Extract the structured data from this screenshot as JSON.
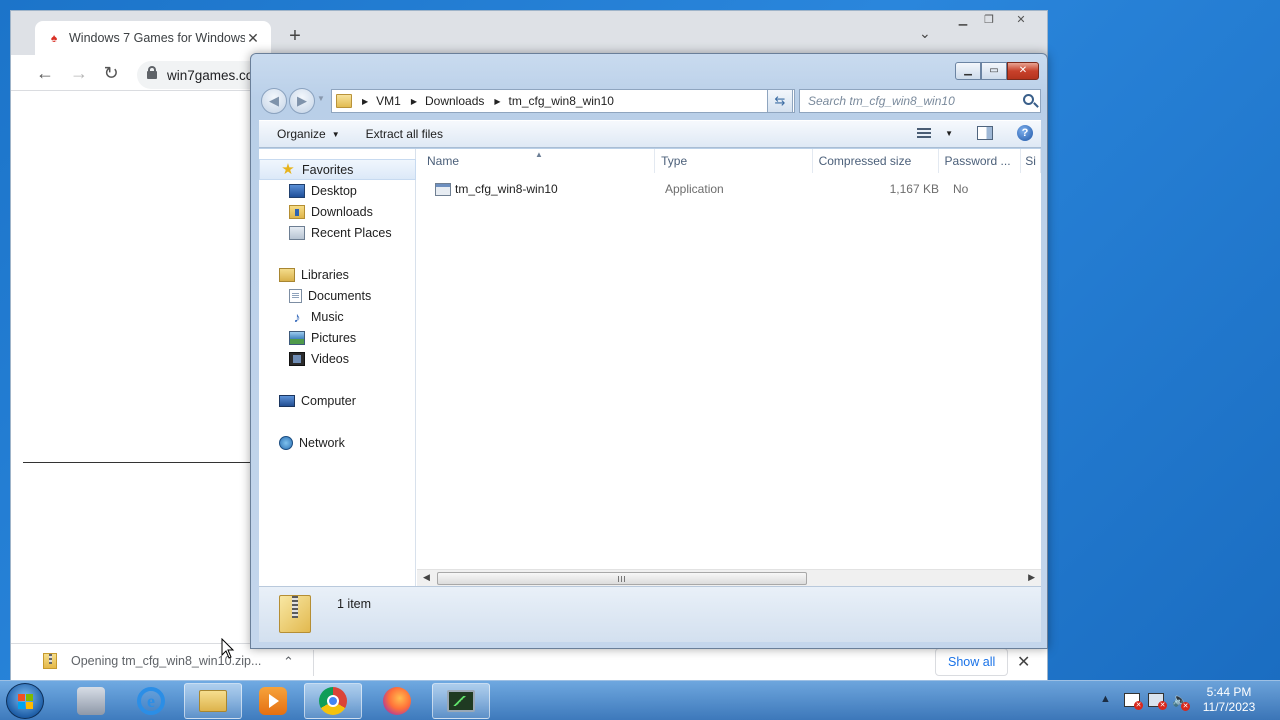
{
  "browser": {
    "tab_title": "Windows 7 Games for Windows",
    "tab_close": "✕",
    "new_tab": "+",
    "tab_menu": "⌄",
    "url": "win7games.co",
    "download": {
      "status": "Opening tm_cfg_win8_win10.zip...",
      "chevron": "⌃",
      "show_all": "Show all",
      "close": "✕"
    }
  },
  "explorer": {
    "address": [
      "VM1",
      "Downloads",
      "tm_cfg_win8_win10"
    ],
    "search_placeholder": "Search tm_cfg_win8_win10",
    "toolbar": {
      "organize": "Organize",
      "extract_all": "Extract all files"
    },
    "nav": {
      "favorites": {
        "label": "Favorites",
        "items": [
          "Desktop",
          "Downloads",
          "Recent Places"
        ]
      },
      "libraries": {
        "label": "Libraries",
        "items": [
          "Documents",
          "Music",
          "Pictures",
          "Videos"
        ]
      },
      "computer": "Computer",
      "network": "Network"
    },
    "columns": {
      "name": "Name",
      "type": "Type",
      "compressed_size": "Compressed size",
      "password": "Password ...",
      "extra": "Si"
    },
    "files": [
      {
        "name": "tm_cfg_win8-win10",
        "type": "Application",
        "compressed_size": "1,167 KB",
        "password": "No"
      }
    ],
    "status": "1 item"
  },
  "taskbar": {
    "apps": [
      "media-center-icon",
      "ie-icon",
      "explorer-icon",
      "wmp-icon",
      "chrome-icon",
      "firefox-icon",
      "task-manager-icon"
    ],
    "clock_time": "5:44 PM",
    "clock_date": "11/7/2023"
  },
  "colors": {
    "desktop_blue": "#1f78cf",
    "explorer_frame": "#c4d6ec",
    "link_blue": "#1a73e8"
  }
}
